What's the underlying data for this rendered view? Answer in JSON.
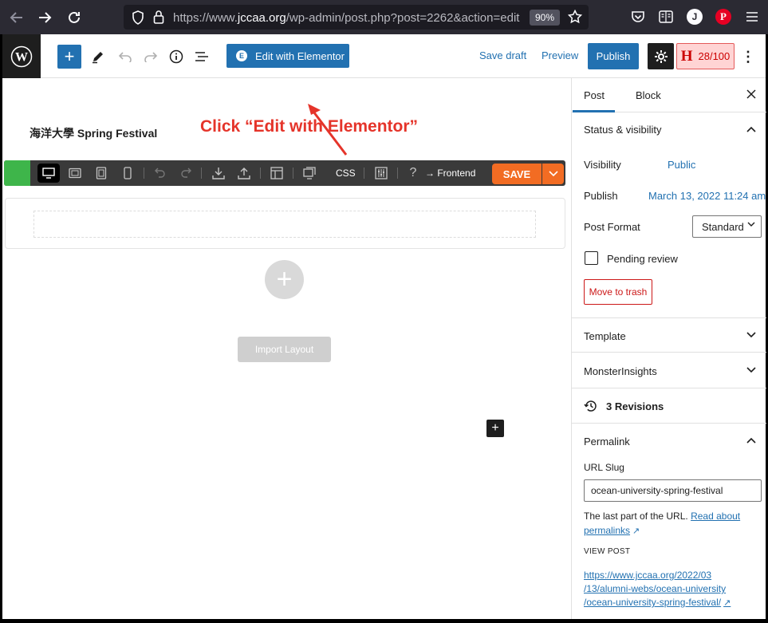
{
  "browser": {
    "url_prefix": "https://www.",
    "url_domain": "jccaa.org",
    "url_path": "/wp-admin/post.php?post=2262&action=edit",
    "zoom": "90%",
    "avatar_letter": "J"
  },
  "toolbar": {
    "elementor_label": "Edit with Elementor",
    "elementor_badge": "E",
    "save_draft": "Save draft",
    "preview": "Preview",
    "publish": "Publish",
    "seo_letter": "H",
    "seo_score": "28/100"
  },
  "canvas": {
    "post_title": "海洋大學 Spring Festival",
    "annotation": "Click “Edit with Elementor”",
    "builder": {
      "css_label": "CSS",
      "frontend_label": "Frontend",
      "save_label": "SAVE"
    },
    "import_layout": "Import Layout"
  },
  "sidebar": {
    "tabs": [
      "Post",
      "Block"
    ],
    "status_visibility": {
      "title": "Status & visibility",
      "visibility_label": "Visibility",
      "visibility_value": "Public",
      "publish_label": "Publish",
      "publish_value": "March 13, 2022 11:24 am",
      "format_label": "Post Format",
      "format_value": "Standard",
      "pending_review": "Pending review",
      "move_to_trash": "Move to trash"
    },
    "template": "Template",
    "monsterinsights": "MonsterInsights",
    "revisions": "3 Revisions",
    "permalink": {
      "title": "Permalink",
      "url_slug_label": "URL Slug",
      "url_slug_value": "ocean-university-spring-festival",
      "help_text": "The last part of the URL.",
      "read_about": "Read about",
      "permalinks": "permalinks",
      "view_post_label": "VIEW POST",
      "post_url_line1": "https://www.jccaa.org/2022/03",
      "post_url_line2": "/13/alumni-webs/ocean-university",
      "post_url_line3": "/ocean-university-spring-festival/"
    }
  },
  "colors": {
    "wp_blue": "#2271b1",
    "annotation_red": "#e5342a",
    "elementor_orange": "#f26c23",
    "builder_green": "#3eb54a"
  }
}
